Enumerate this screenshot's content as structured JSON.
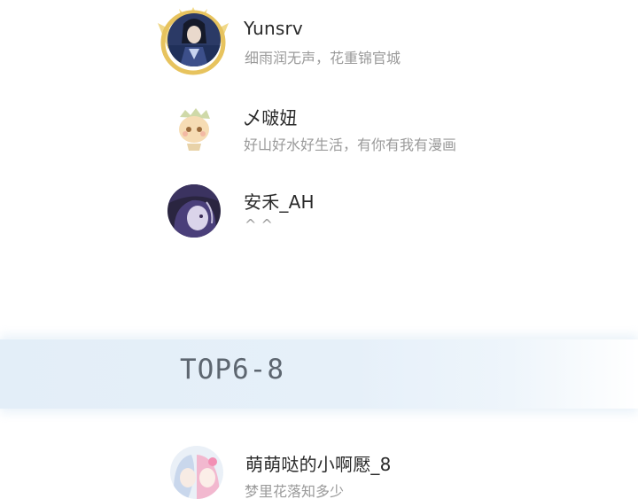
{
  "users_top": [
    {
      "name": "Yunsrv",
      "signature": "细雨润无声，花重锦官城",
      "avatar_icon": "anime-warrior-avatar-with-gold-frame"
    },
    {
      "name": "乄啵妞",
      "signature": "好山好水好生活，有你有我有漫画",
      "avatar_icon": "cartoon-character-avatar"
    },
    {
      "name": "安禾_AH",
      "signature": "^ ^",
      "avatar_icon": "dark-anime-girl-avatar"
    }
  ],
  "section": {
    "title": "TOP6-8"
  },
  "users_bottom": [
    {
      "name": "萌萌哒的小啊懕_8",
      "signature": "梦里花落知多少",
      "avatar_icon": "pastel-anime-girl-avatar"
    }
  ],
  "colors": {
    "name_text": "#2a2a2a",
    "signature_text": "#9a9a9a",
    "section_band": "#e4eff8",
    "section_title": "#5d6670"
  }
}
